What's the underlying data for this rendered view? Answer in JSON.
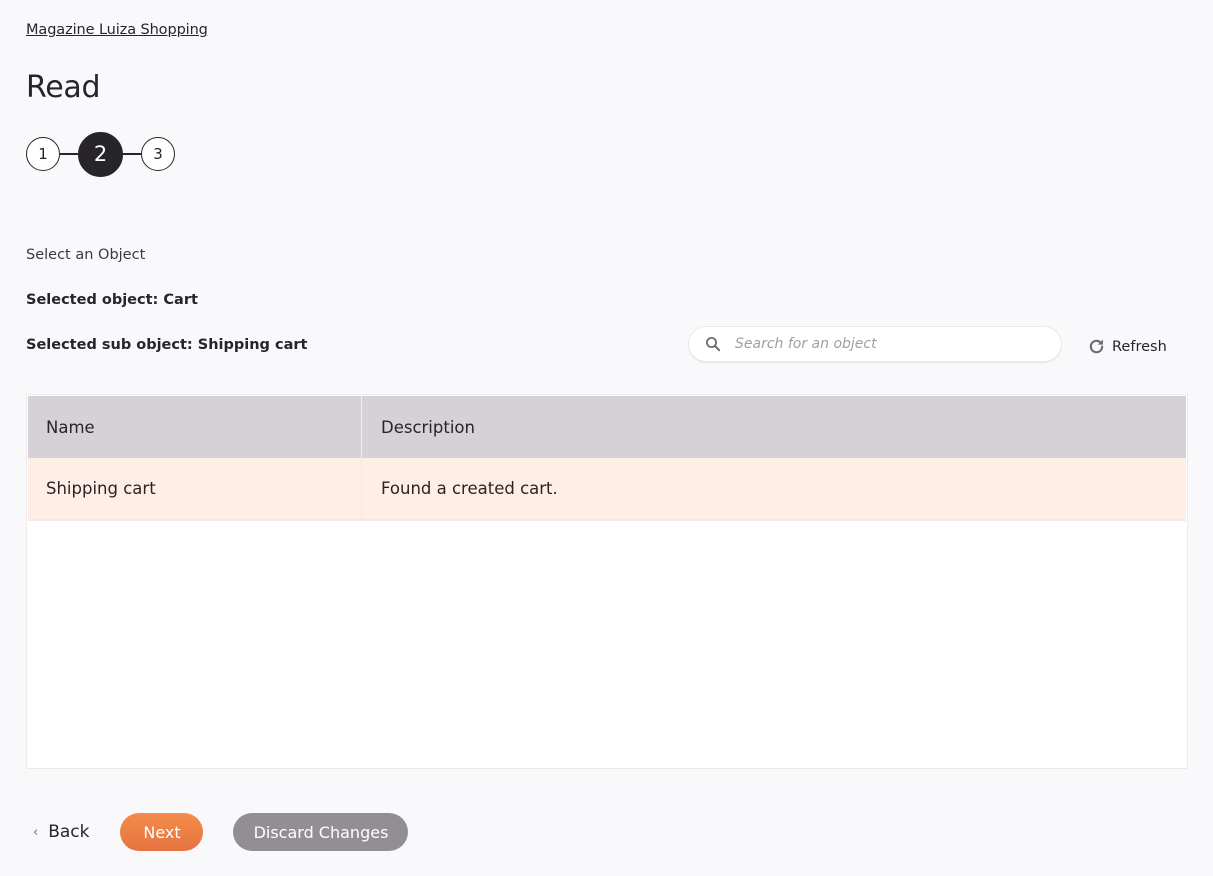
{
  "breadcrumb": {
    "label": "Magazine Luiza Shopping"
  },
  "page": {
    "title": "Read"
  },
  "stepper": {
    "steps": [
      {
        "label": "1",
        "state": "inactive"
      },
      {
        "label": "2",
        "state": "active"
      },
      {
        "label": "3",
        "state": "inactive"
      }
    ],
    "current_step": 2
  },
  "selection": {
    "heading": "Select an Object",
    "selected_object": "Selected object: Cart",
    "selected_sub_object": "Selected sub object: Shipping cart"
  },
  "search": {
    "placeholder": "Search for an object",
    "value": "",
    "icon": "search-icon"
  },
  "refresh": {
    "label": "Refresh",
    "icon": "refresh-icon"
  },
  "table": {
    "columns": [
      "Name",
      "Description"
    ],
    "rows": [
      {
        "name": "Shipping cart",
        "description": "Found a created cart.",
        "selected": true
      }
    ]
  },
  "footer": {
    "back_label": "Back",
    "back_icon": "chevron-left-icon",
    "next_label": "Next",
    "discard_label": "Discard Changes"
  },
  "colors": {
    "accent": "#ee7f45",
    "selected_row": "#ffeee6",
    "header_bg": "#d6d1d6",
    "discard_bg": "#938e94",
    "active_step": "#27252a"
  }
}
